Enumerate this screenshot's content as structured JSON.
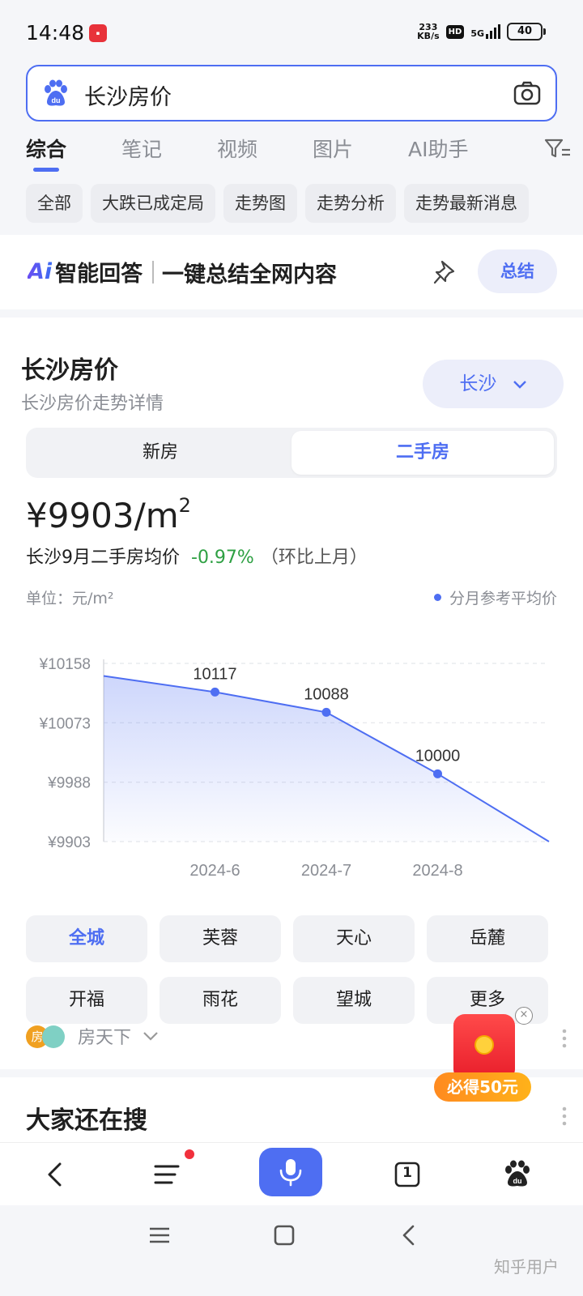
{
  "status_bar": {
    "time": "14:48",
    "net_speed_value": "233",
    "net_speed_unit": "KB/s",
    "hd": "HD",
    "network": "5G",
    "battery": "40"
  },
  "search": {
    "query": "长沙房价"
  },
  "tabs": [
    "综合",
    "笔记",
    "视频",
    "图片",
    "AI助手"
  ],
  "active_tab": 0,
  "chips": [
    "全部",
    "大跌已成定局",
    "走势图",
    "走势分析",
    "走势最新消息"
  ],
  "ai_answer": {
    "logo_mark": "Ai",
    "logo_text": "智能回答",
    "tagline": "一键总结全网内容",
    "summary_button": "总结"
  },
  "price_card": {
    "title": "长沙房价",
    "subtitle": "长沙房价走势详情",
    "city": "长沙",
    "segments": [
      "新房",
      "二手房"
    ],
    "active_segment": 1,
    "price_value": "¥9903/m",
    "price_sup": "2",
    "desc_prefix": "长沙9月二手房均价",
    "change": "-0.97%",
    "compare": "（环比上月）",
    "unit_label": "单位：元/m²",
    "legend": "分月参考平均价",
    "districts": [
      "全城",
      "芙蓉",
      "天心",
      "岳麓",
      "开福",
      "雨花",
      "望城",
      "更多"
    ],
    "active_district": 0,
    "source_name": "房天下",
    "source_logo_char": "房"
  },
  "chart_data": {
    "type": "area",
    "x": [
      "2024-5",
      "2024-6",
      "2024-7",
      "2024-8",
      "2024-9"
    ],
    "x_tick_labels": [
      "2024-6",
      "2024-7",
      "2024-8"
    ],
    "values": [
      10140,
      10117,
      10088,
      10000,
      9903
    ],
    "point_labels": [
      "10117",
      "10088",
      "10000"
    ],
    "y_ticks": [
      "¥10158",
      "¥10073",
      "¥9988",
      "¥9903"
    ],
    "ylim": [
      9903,
      10158
    ],
    "series_color": "#4e6ef2",
    "grid": true
  },
  "red_packet": {
    "label": "必得50元",
    "close": "×"
  },
  "also_search": {
    "title": "大家还在搜"
  },
  "bottom_bar": {
    "tab_count": "1"
  },
  "watermark": "知乎用户"
}
